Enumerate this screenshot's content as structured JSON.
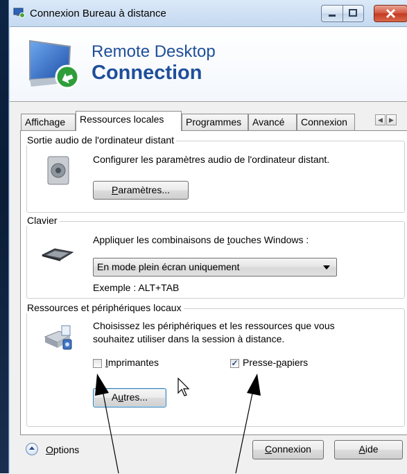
{
  "window": {
    "title": "Connexion Bureau à distance",
    "controls": {
      "minimize": "minimize-icon",
      "maximize": "maximize-icon",
      "close": "close-icon"
    }
  },
  "banner": {
    "line1": "Remote Desktop",
    "line2": "Connection"
  },
  "tabs": [
    {
      "label": "Affichage",
      "active": false
    },
    {
      "label": "Ressources locales",
      "active": true
    },
    {
      "label": "Programmes",
      "active": false
    },
    {
      "label": "Avancé",
      "active": false
    },
    {
      "label": "Connexion",
      "active": false
    }
  ],
  "audio_group": {
    "title": "Sortie audio de l'ordinateur distant",
    "description": "Configurer les paramètres audio de l'ordinateur distant.",
    "button": {
      "prefix": "",
      "mnemonic": "P",
      "rest": "aramètres..."
    }
  },
  "keyboard_group": {
    "title": "Clavier",
    "description_prefix": "Appliquer les combinaisons de ",
    "description_mnemonic": "t",
    "description_rest": "ouches Windows :",
    "selected_option": "En mode plein écran uniquement",
    "example": "Exemple : ALT+TAB"
  },
  "resources_group": {
    "title": "Ressources et périphériques locaux",
    "description_line1": "Choisissez les périphériques et les ressources que vous",
    "description_line2": "souhaitez utiliser dans la session à distance.",
    "printers": {
      "mnemonic": "I",
      "rest": "mprimantes",
      "checked": false
    },
    "clipboard": {
      "prefix": "Presse-",
      "mnemonic": "p",
      "rest": "apiers",
      "checked": true
    },
    "other_button": {
      "prefix": "A",
      "mnemonic": "u",
      "rest": "tres..."
    }
  },
  "footer": {
    "options": {
      "mnemonic": "O",
      "rest": "ptions"
    },
    "connect": {
      "mnemonic": "C",
      "rest": "onnexion"
    },
    "help": {
      "mnemonic": "A",
      "rest": "ide"
    }
  },
  "colors": {
    "banner_text": "#1e4f99",
    "window_frame": "#c9dcf2",
    "close_button": "#c23a22"
  }
}
